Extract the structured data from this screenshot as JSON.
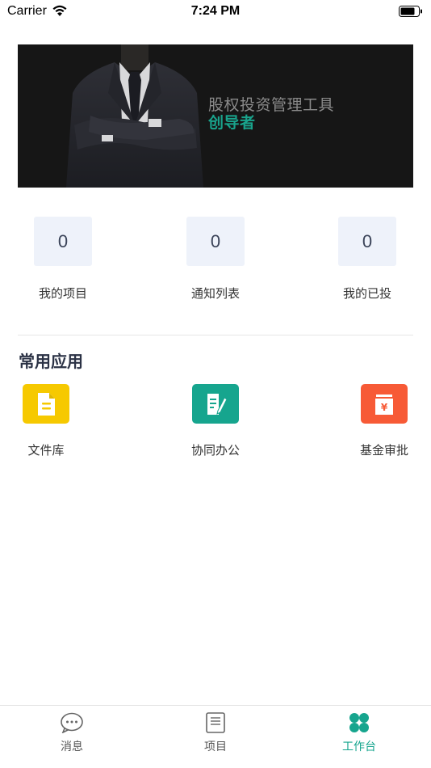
{
  "status_bar": {
    "carrier": "Carrier",
    "time": "7:24 PM"
  },
  "banner": {
    "title": "股权投资管理工具",
    "subtitle": "创导者"
  },
  "stats": [
    {
      "value": "0",
      "label": "我的项目"
    },
    {
      "value": "0",
      "label": "通知列表"
    },
    {
      "value": "0",
      "label": "我的已投"
    }
  ],
  "section": {
    "title": "常用应用"
  },
  "apps": [
    {
      "label": "文件库",
      "icon": "document-icon",
      "color": "#f6c900"
    },
    {
      "label": "协同办公",
      "icon": "edit-document-icon",
      "color": "#16a58e"
    },
    {
      "label": "基金审批",
      "icon": "yen-calendar-icon",
      "color": "#f75a36"
    }
  ],
  "tabs": [
    {
      "label": "消息",
      "icon": "chat-bubble-icon",
      "active": false
    },
    {
      "label": "项目",
      "icon": "notebook-icon",
      "active": false
    },
    {
      "label": "工作台",
      "icon": "clover-icon",
      "active": true
    }
  ],
  "colors": {
    "accent": "#16a58e",
    "stat_bg": "#eef2fa"
  }
}
